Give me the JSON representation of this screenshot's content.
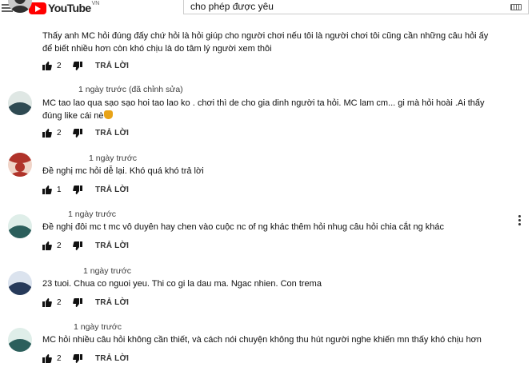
{
  "header": {
    "logo_text": "YouTube",
    "logo_region": "VN",
    "search_value": "cho phép được yêu"
  },
  "labels": {
    "reply": "TRẢ LỜI"
  },
  "comments": [
    {
      "meta": "",
      "text": "Thấy anh MC hỏi đúng đấy chứ hỏi là hỏi giúp cho người chơi nếu tôi là người chơi tôi cũng cần những câu hỏi ấy để biết nhiều hơn còn khó chịu là do tâm lý người xem thôi",
      "likes": "2",
      "avatar_colors": [
        "#2f2f2f",
        "#c8c8c8"
      ]
    },
    {
      "meta": "1 ngày trước (đã chỉnh sửa)",
      "text": "MC tao lao qua sạo sạo hoi tao lao ko . chơi thì de cho gia dinh người ta hỏi. MC  lam cm... gi mà hỏi hoài .Ai thấy đúng like cái nè",
      "likes": "2",
      "avatar_colors": [
        "#2e4a52",
        "#dfe7e4"
      ]
    },
    {
      "meta": "1 ngày trước",
      "text": "Đề nghị mc hỏi dễ lại. Khó quá khó trả lời",
      "likes": "1",
      "avatar_colors": [
        "#b0332a",
        "#f0d4c8"
      ]
    },
    {
      "meta": "1 ngày trước",
      "text": "Đề nghị đôi mc t     mc vô duyên hay chen vào cuộc nc of ng khác thêm hỏi nhug câu hỏi chia cắt ng khác",
      "likes": "2",
      "avatar_colors": [
        "#2c5f5c",
        "#dfeee9"
      ]
    },
    {
      "meta": "1 ngày trước",
      "text": "23 tuoi. Chua co nguoi yeu. Thi co gi la dau ma. Ngac nhien.   Con trema",
      "likes": "2",
      "avatar_colors": [
        "#263a5a",
        "#dbe3ee"
      ]
    },
    {
      "meta": "1 ngày trước",
      "text": "MC hỏi nhiều câu hỏi không cần thiết, và cách nói chuyện không thu hút người nghe khiến mn thấy khó chịu hơn",
      "likes": "2",
      "avatar_colors": [
        "#2c5f5c",
        "#dfeee9"
      ]
    }
  ]
}
